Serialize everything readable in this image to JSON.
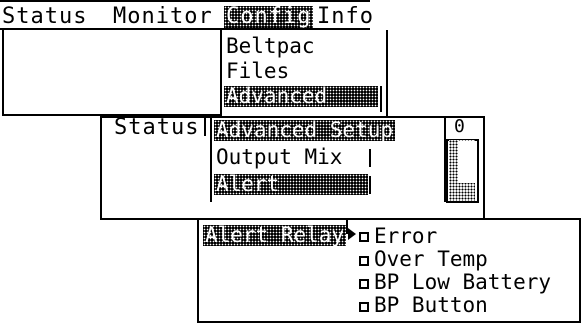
{
  "menubar": {
    "items": [
      "Status",
      "Monitor",
      "Config",
      "Info"
    ],
    "active": "Config"
  },
  "config_menu": {
    "items": [
      "Beltpac",
      "Files",
      "Advanced"
    ],
    "selected": "Advanced"
  },
  "advanced_panel": {
    "status_label": "Status",
    "title": "Advanced Setup",
    "items": [
      "Output Mix",
      "Alert"
    ],
    "selected": "Alert",
    "level_value": "0"
  },
  "alert_relay_panel": {
    "title": "Alert Relay",
    "options": [
      "Error",
      "Over Temp",
      "BP Low Battery",
      "BP Button"
    ]
  },
  "colors": {
    "foreground": "#000000",
    "background": "#ffffff"
  }
}
